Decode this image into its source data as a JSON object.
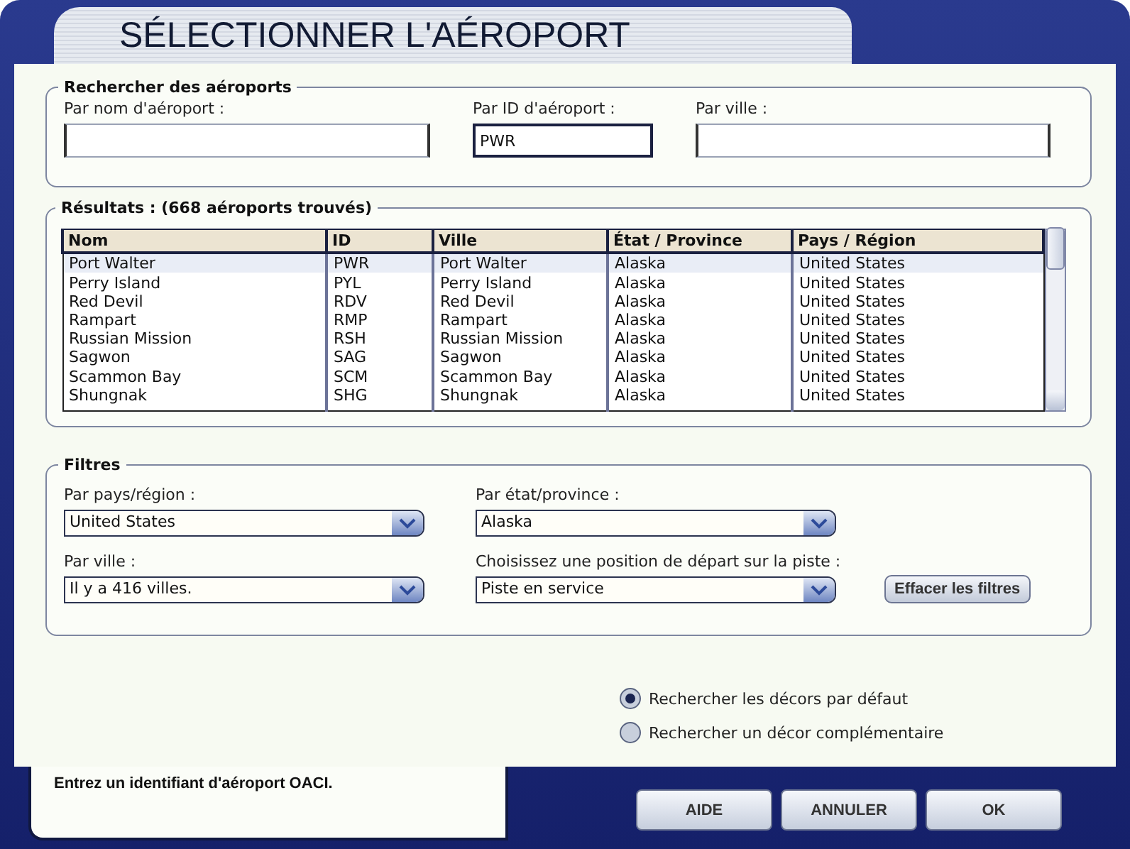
{
  "window": {
    "title": "SÉLECTIONNER L'AÉROPORT"
  },
  "search": {
    "title": "Rechercher des aéroports",
    "fields": [
      {
        "label": "Par nom d'aéroport :",
        "focused": false
      },
      {
        "label": "Par ID d'aéroport :",
        "value": "PWR",
        "focused": true
      },
      {
        "label": "Par ville :",
        "focused": false
      }
    ]
  },
  "results": {
    "title": "Résultats : (668 aéroports trouvés)",
    "columns": [
      "Nom",
      "ID",
      "Ville",
      "État / Province",
      "Pays / Région"
    ],
    "rows": [
      {
        "cells": [
          "Port Walter",
          "PWR",
          "Port Walter",
          "Alaska",
          "United States"
        ],
        "selected": true
      },
      {
        "cells": [
          "Perry Island",
          "PYL",
          "Perry Island",
          "Alaska",
          "United States"
        ],
        "selected": false
      },
      {
        "cells": [
          "Red Devil",
          "RDV",
          "Red Devil",
          "Alaska",
          "United States"
        ],
        "selected": false
      },
      {
        "cells": [
          "Rampart",
          "RMP",
          "Rampart",
          "Alaska",
          "United States"
        ],
        "selected": false
      },
      {
        "cells": [
          "Russian Mission",
          "RSH",
          "Russian Mission",
          "Alaska",
          "United States"
        ],
        "selected": false
      },
      {
        "cells": [
          "Sagwon",
          "SAG",
          "Sagwon",
          "Alaska",
          "United States"
        ],
        "selected": false
      },
      {
        "cells": [
          "Scammon Bay",
          "SCM",
          "Scammon Bay",
          "Alaska",
          "United States"
        ],
        "selected": false
      },
      {
        "cells": [
          "Shungnak",
          "SHG",
          "Shungnak",
          "Alaska",
          "United States"
        ],
        "selected": false
      }
    ]
  },
  "filters": {
    "title": "Filtres",
    "dropdowns": [
      {
        "label": "Par pays/région :",
        "value": "United States"
      },
      {
        "label": "Par état/province :",
        "value": "Alaska"
      },
      {
        "label": "Par ville :",
        "value": "Il y a 416 villes."
      },
      {
        "label": "Choisissez une position de départ sur la piste :",
        "value": "Piste en service"
      }
    ],
    "clear_button": "Effacer les filtres"
  },
  "scenery_options": [
    {
      "label": "Rechercher les décors par défaut",
      "selected": true
    },
    {
      "label": "Rechercher un décor complémentaire",
      "selected": false
    }
  ],
  "status_bar": {
    "message": "Entrez un identifiant d'aéroport OACI."
  },
  "buttons": [
    "AIDE",
    "ANNULER",
    "OK"
  ]
}
